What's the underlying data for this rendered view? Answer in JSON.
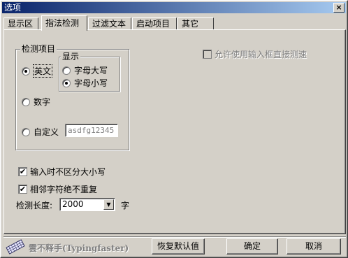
{
  "window": {
    "title": "选项",
    "close_glyph": "×"
  },
  "tabs": [
    {
      "label": "显示区",
      "active": false
    },
    {
      "label": "指法检测",
      "active": true
    },
    {
      "label": "过滤文本",
      "active": false
    },
    {
      "label": "启动项目",
      "active": false
    },
    {
      "label": "其它",
      "active": false
    }
  ],
  "detect_group": {
    "title": "检测项目",
    "english_label": "英文",
    "english_selected": true,
    "display_group": {
      "title": "显示",
      "uppercase_label": "字母大写",
      "uppercase_selected": false,
      "lowercase_label": "字母小写",
      "lowercase_selected": true
    },
    "digits_label": "数字",
    "digits_selected": false,
    "custom_label": "自定义",
    "custom_selected": false,
    "custom_value": "asdfg12345"
  },
  "allow_input_label": "允许使用输入框直接测速",
  "allow_input_checked": false,
  "case_insensitive_label": "输入时不区分大小写",
  "case_insensitive_checked": true,
  "no_repeat_label": "相邻字符绝不重复",
  "no_repeat_checked": true,
  "length": {
    "label": "检测长度:",
    "value": "2000",
    "unit": "字"
  },
  "footer": {
    "brand": "雲不释手(Typingfaster)",
    "restore_label": "恢复默认值",
    "ok_label": "确定",
    "cancel_label": "取消"
  },
  "colors": {
    "titlebar_start": "#0a246a",
    "titlebar_end": "#a6caf0",
    "face": "#d4d0c8"
  }
}
